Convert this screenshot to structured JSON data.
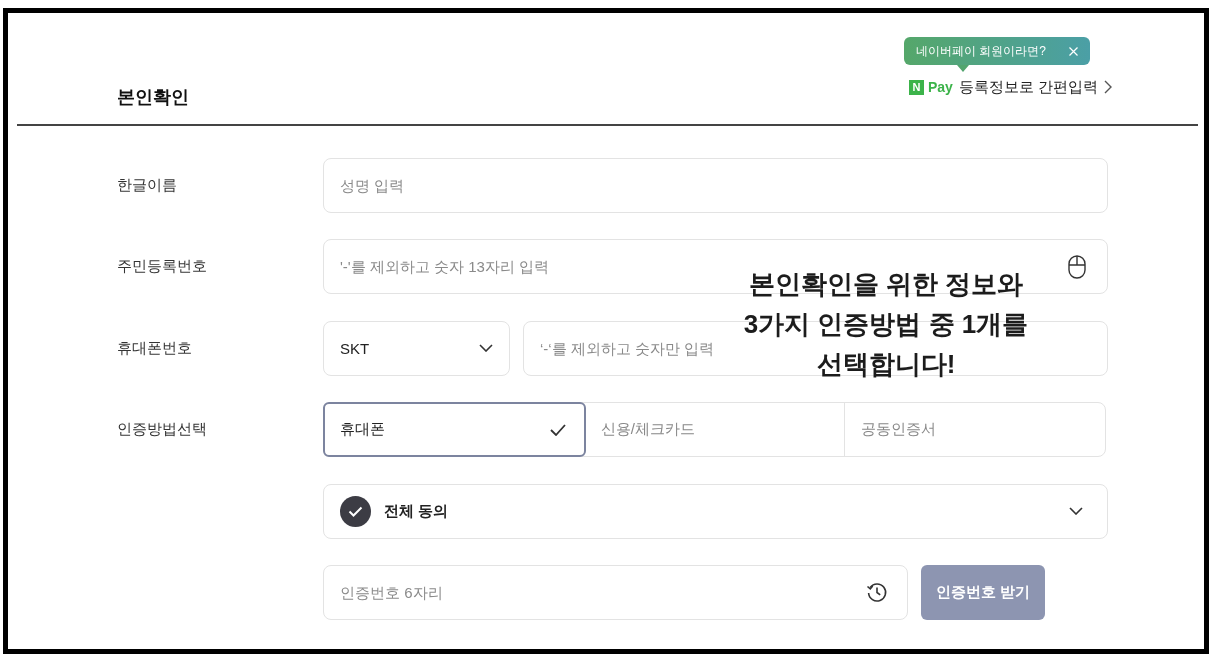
{
  "header": {
    "title": "본인확인",
    "tooltip": {
      "text": "네이버페이 회원이라면?"
    },
    "npay": {
      "logo_mark": "N",
      "logo_text": "Pay",
      "label": "등록정보로 간편입력"
    }
  },
  "form": [
    {
      "kind": "text",
      "label": "한글이름",
      "placeholder": "성명 입력"
    },
    {
      "kind": "secure",
      "label": "주민등록번호",
      "placeholder": "'-'를 제외하고 숫자 13자리 입력"
    },
    {
      "kind": "phone",
      "label": "휴대폰번호",
      "carrier": "SKT",
      "placeholder": "‘-‘를 제외하고 숫자만 입력"
    },
    {
      "kind": "methods",
      "label": "인증방법선택",
      "options": [
        {
          "label": "휴대폰",
          "selected": true
        },
        {
          "label": "신용/체크카드",
          "selected": false
        },
        {
          "label": "공동인증서",
          "selected": false
        }
      ]
    }
  ],
  "agreement": {
    "label": "전체 동의",
    "checked": true
  },
  "verification": {
    "placeholder": "인증번호 6자리",
    "button": {
      "label": "인증번호 받기",
      "disabled": true
    }
  },
  "annotation": "본인확인을 위한 정보와\n3가지 인증방법 중 1개를\n선택합니다!"
}
